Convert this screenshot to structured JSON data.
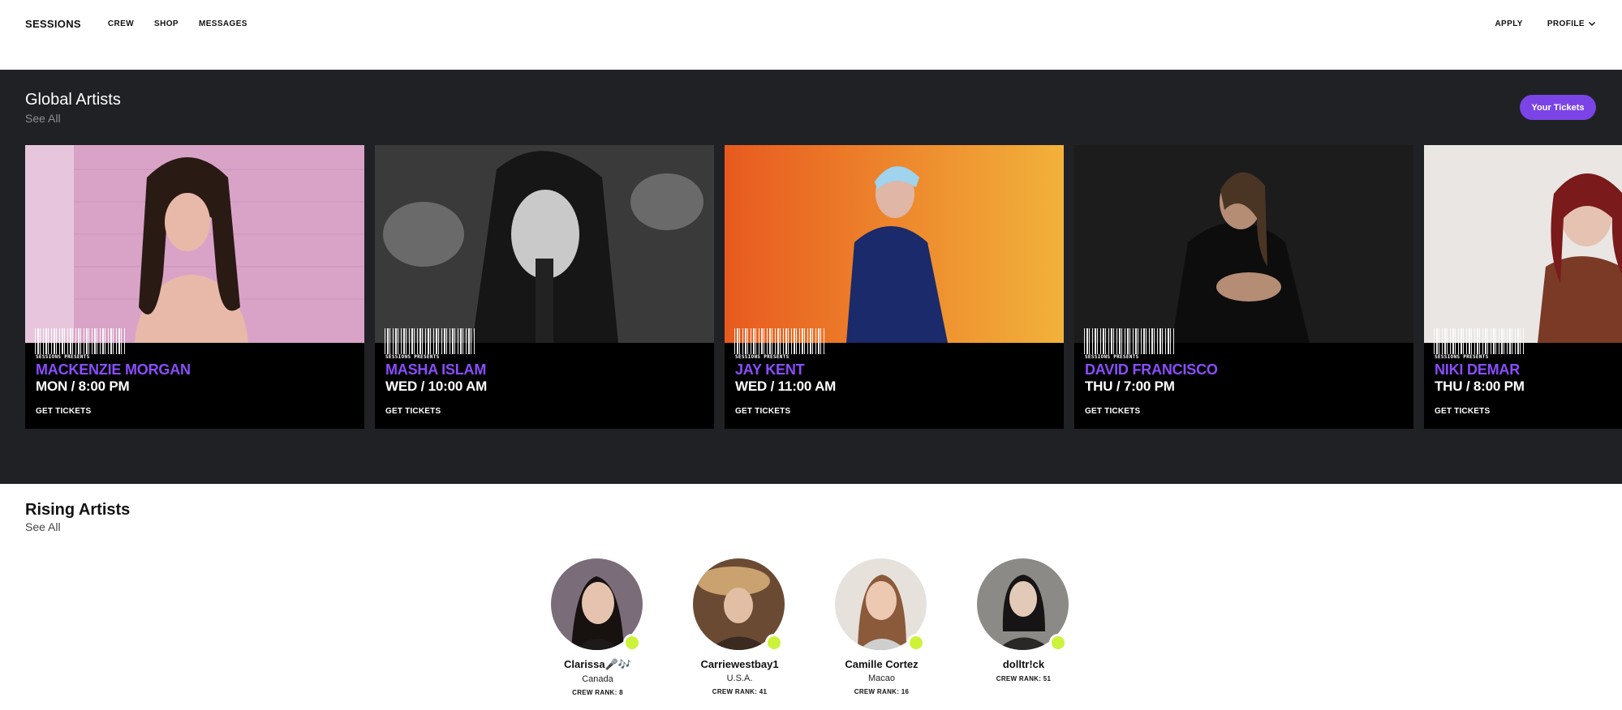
{
  "nav": {
    "brand": "SESSIONS",
    "links": [
      "CREW",
      "SHOP",
      "MESSAGES"
    ],
    "apply": "APPLY",
    "profile": "PROFILE"
  },
  "global": {
    "title": "Global Artists",
    "see_all": "See All",
    "tickets_button": "Your Tickets",
    "cards": [
      {
        "presents": "SESSIONS PRESENTS",
        "name": "MACKENZIE MORGAN",
        "time": "MON / 8:00 PM",
        "cta": "GET TICKETS"
      },
      {
        "presents": "SESSIONS PRESENTS",
        "name": "MASHA ISLAM",
        "time": "WED / 10:00 AM",
        "cta": "GET TICKETS"
      },
      {
        "presents": "SESSIONS PRESENTS",
        "name": "JAY KENT",
        "time": "WED / 11:00 AM",
        "cta": "GET TICKETS"
      },
      {
        "presents": "SESSIONS PRESENTS",
        "name": "DAVID FRANCISCO",
        "time": "THU / 7:00 PM",
        "cta": "GET TICKETS"
      },
      {
        "presents": "SESSIONS PRESENTS",
        "name": "NIKI DEMAR",
        "time": "THU / 8:00 PM",
        "cta": "GET TICKETS"
      }
    ]
  },
  "rising": {
    "title": "Rising Artists",
    "see_all": "See All",
    "artists": [
      {
        "name": "Clarissa🎤🎶",
        "location": "Canada",
        "rank": "CREW RANK: 8"
      },
      {
        "name": "Carriewestbay1",
        "location": "U.S.A.",
        "rank": "CREW RANK: 41"
      },
      {
        "name": "Camille Cortez",
        "location": "Macao",
        "rank": "CREW RANK: 16"
      },
      {
        "name": "dolltr!ck",
        "location": "",
        "rank": "CREW RANK: 51"
      }
    ]
  },
  "colors": {
    "accent": "#7a44e6",
    "artist_name": "#8a4dff",
    "dark_band": "#202125",
    "online_dot": "#cdf23a"
  }
}
